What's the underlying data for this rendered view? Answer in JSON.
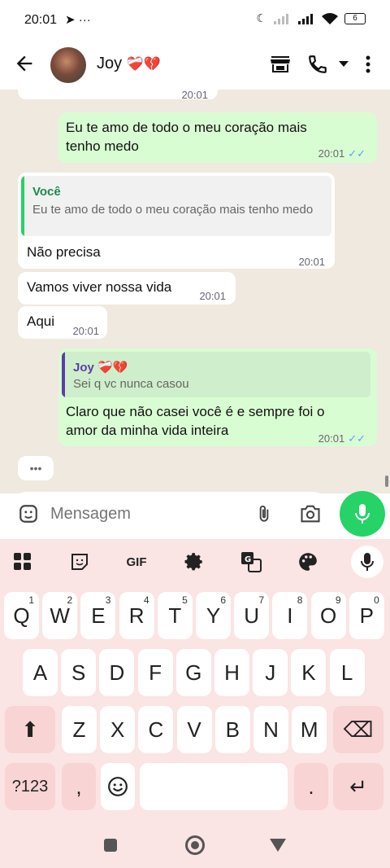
{
  "status_bar": {
    "time": "20:01",
    "left_icons": "➤ ···",
    "battery": "6"
  },
  "contact": {
    "name": "Joy",
    "emoji": "❤️‍🩹💔"
  },
  "messages": [
    {
      "dir": "in",
      "text": "",
      "time": "20:01"
    },
    {
      "dir": "out",
      "text": "Eu te amo de todo o meu coração mais tenho medo",
      "time": "20:01"
    },
    {
      "dir": "in",
      "quote_name": "Você",
      "quote_text": "Eu te amo de todo o meu coração mais tenho medo",
      "text": "Não precisa",
      "time": "20:01"
    },
    {
      "dir": "in",
      "text": "Vamos viver nossa vida",
      "time": "20:01"
    },
    {
      "dir": "in",
      "text": "Aqui",
      "time": "20:01"
    },
    {
      "dir": "out",
      "quote_name": "Joy ❤️‍🩹💔",
      "quote_text": "Sei q vc nunca casou",
      "text": "Claro que não casei você é e sempre foi o amor da minha vida inteira",
      "time": "20:01"
    }
  ],
  "typing": "•••",
  "composer": {
    "placeholder": "Mensagem"
  },
  "keyboard": {
    "toolbar": {
      "gif": "GIF"
    },
    "row1": [
      {
        "k": "Q",
        "h": "1"
      },
      {
        "k": "W",
        "h": "2"
      },
      {
        "k": "E",
        "h": "3"
      },
      {
        "k": "R",
        "h": "4"
      },
      {
        "k": "T",
        "h": "5"
      },
      {
        "k": "Y",
        "h": "6"
      },
      {
        "k": "U",
        "h": "7"
      },
      {
        "k": "I",
        "h": "8"
      },
      {
        "k": "O",
        "h": "9"
      },
      {
        "k": "P",
        "h": "0"
      }
    ],
    "row2": [
      "A",
      "S",
      "D",
      "F",
      "G",
      "H",
      "J",
      "K",
      "L"
    ],
    "row3": [
      "Z",
      "X",
      "C",
      "V",
      "B",
      "N",
      "M"
    ],
    "sym": "?123",
    "comma": ",",
    "period": ".",
    "enter": "↵",
    "shift": "⬆",
    "backspace": "⌫"
  },
  "colors": {
    "accent": "#25d366",
    "tick": "#53a6f0",
    "quote_in": "#25d366",
    "quote_out": "#5b3ea8"
  }
}
